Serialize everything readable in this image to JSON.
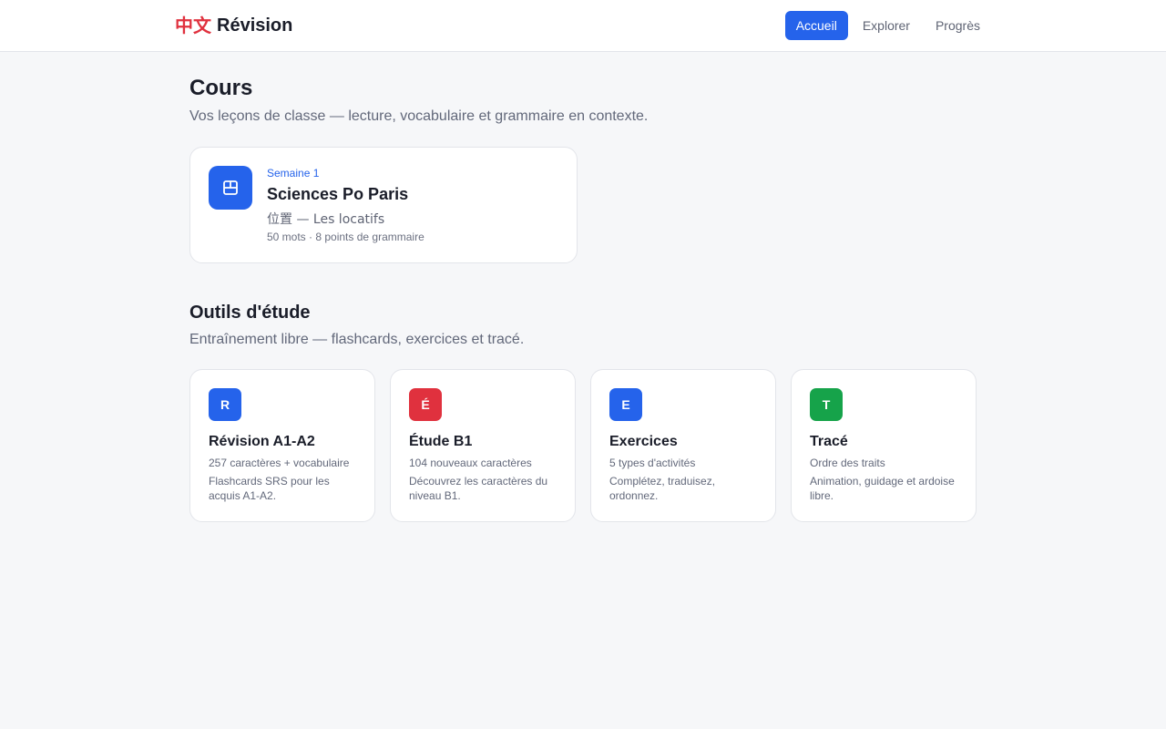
{
  "header": {
    "logo_cn": "中文",
    "logo_text": "Révision",
    "nav": [
      {
        "label": "Accueil",
        "active": true
      },
      {
        "label": "Explorer",
        "active": false
      },
      {
        "label": "Progrès",
        "active": false
      }
    ]
  },
  "courses": {
    "title": "Cours",
    "subtitle": "Vos leçons de classe — lecture, vocabulaire et grammaire en contexte.",
    "card": {
      "icon": "book-icon",
      "week": "Semaine 1",
      "name": "Sciences Po Paris",
      "sub": "位置 — Les locatifs",
      "meta": "50 mots · 8 points de grammaire"
    }
  },
  "tools": {
    "title": "Outils d'étude",
    "subtitle": "Entraînement libre — flashcards, exercices et tracé.",
    "items": [
      {
        "badge": "R",
        "color": "#2563eb",
        "name": "Révision A1-A2",
        "meta": "257 caractères + vocabulaire",
        "desc": "Flashcards SRS pour les acquis A1-A2."
      },
      {
        "badge": "É",
        "color": "#e0313e",
        "name": "Étude B1",
        "meta": "104 nouveaux caractères",
        "desc": "Découvrez les caractères du niveau B1."
      },
      {
        "badge": "E",
        "color": "#2563eb",
        "name": "Exercices",
        "meta": "5 types d'activités",
        "desc": "Complétez, traduisez, ordonnez."
      },
      {
        "badge": "T",
        "color": "#16a34a",
        "name": "Tracé",
        "meta": "Ordre des traits",
        "desc": "Animation, guidage et ardoise libre."
      }
    ]
  },
  "colors": {
    "accent": "#2563eb",
    "brand_red": "#e0313e",
    "green": "#16a34a"
  }
}
